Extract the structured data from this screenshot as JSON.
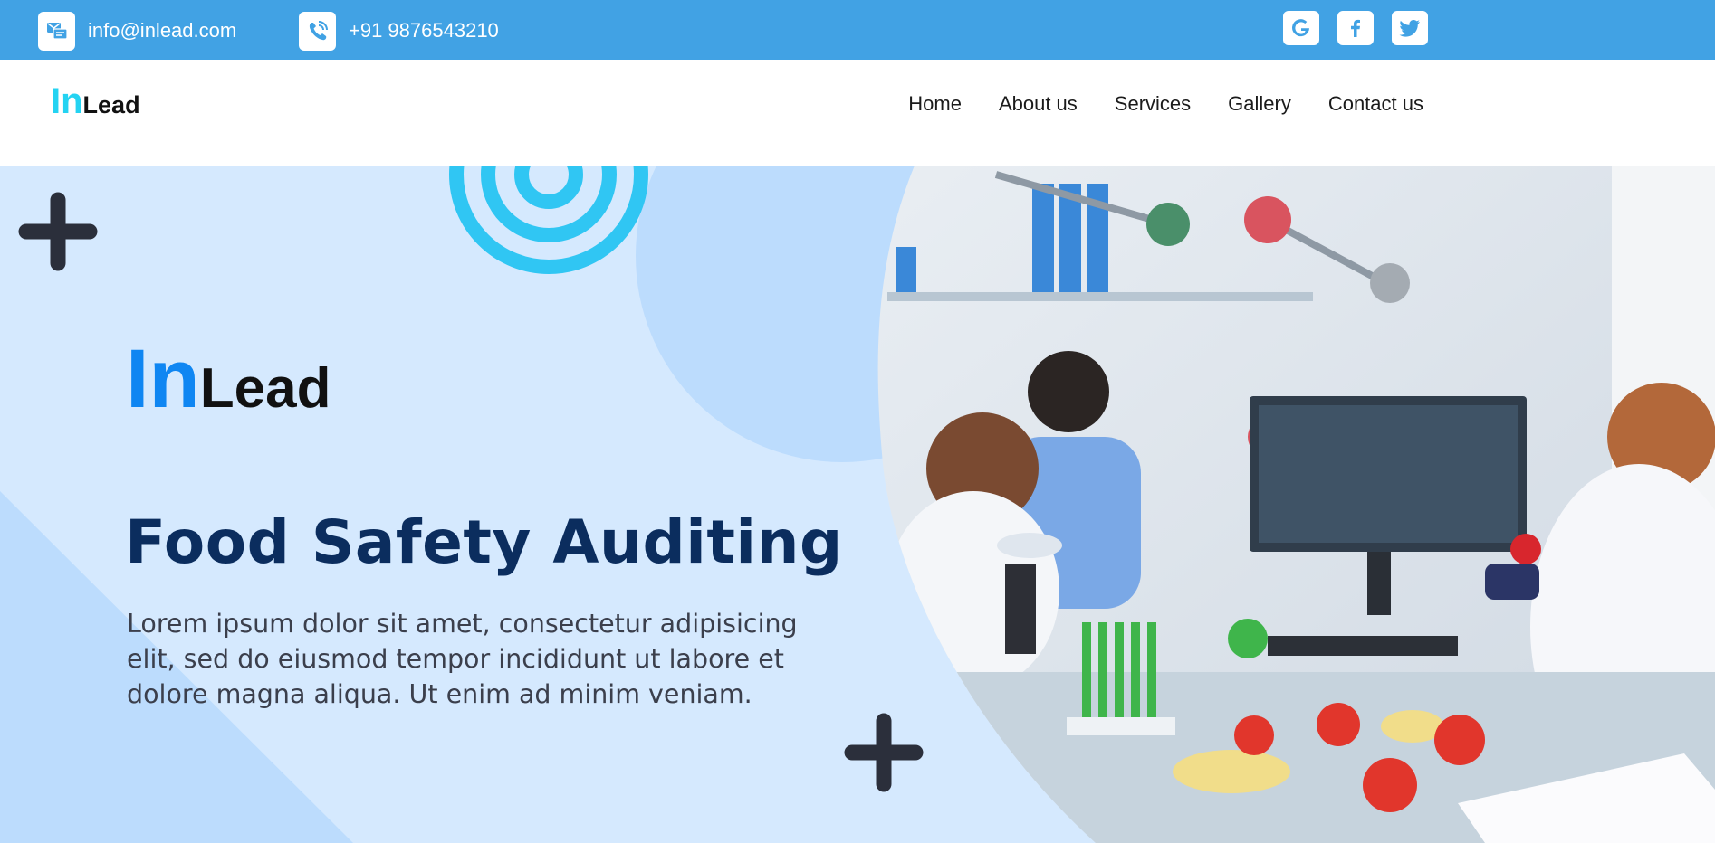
{
  "topbar": {
    "email": "info@inlead.com",
    "phone": "+91 9876543210",
    "email_icon": "mail-icon",
    "phone_icon": "phone-icon",
    "social": [
      "google-icon",
      "facebook-icon",
      "twitter-icon"
    ],
    "background": "#41a2e4"
  },
  "navbar": {
    "logo_in": "In",
    "logo_lead": "Lead",
    "links": [
      "Home",
      "About us",
      "Services",
      "Gallery",
      "Contact us"
    ]
  },
  "hero": {
    "logo_in": "In",
    "logo_lead": "Lead",
    "title": "Food Safety Auditing",
    "description": "Lorem ipsum dolor sit amet, consectetur adipisicing elit, sed do eiusmod tempor incididunt ut labore et dolore magna aliqua. Ut enim ad minim veniam.",
    "image": "laboratory-photo",
    "decorations": [
      "plus-icon",
      "target-rings",
      "plus-icon"
    ]
  },
  "colors": {
    "accent_cyan": "#24d3f2",
    "brand_blue": "#0f86f2",
    "headline_navy": "#0b2d5e",
    "hero_background": "#d5e9fe"
  }
}
